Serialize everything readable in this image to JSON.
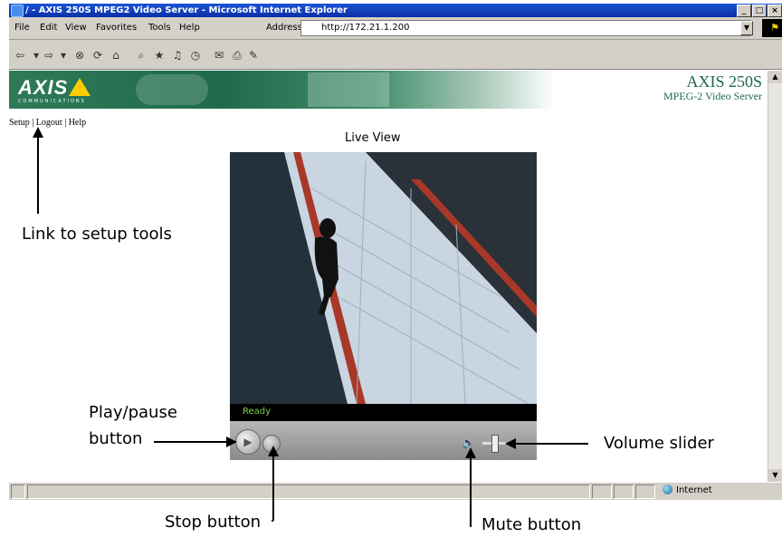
{
  "window": {
    "title": "/ - AXIS 250S MPEG2 Video Server - Microsoft Internet Explorer",
    "controls": [
      "_",
      "□",
      "×"
    ]
  },
  "menu": [
    "File",
    "Edit",
    "View",
    "Favorites",
    "Tools",
    "Help"
  ],
  "address": {
    "label": "Address",
    "url": "http://172.21.1.200"
  },
  "toolbar_icons": [
    "back-icon",
    "forward-icon",
    "stop-icon",
    "refresh-icon",
    "home-icon",
    "search-icon",
    "favorites-icon",
    "media-icon",
    "history-icon",
    "mail-icon",
    "print-icon",
    "edit-icon"
  ],
  "banner": {
    "logo": "AXIS",
    "logo_sub": "COMMUNICATIONS",
    "product_name": "AXIS 250S",
    "product_sub": "MPEG-2 Video Server"
  },
  "nav_links": [
    "Setup",
    "Logout",
    "Help"
  ],
  "nav_separator": "|",
  "live_view_title": "Live View",
  "player": {
    "status": "Ready",
    "volume_level": 0.5
  },
  "statusbar": {
    "zone": "Internet"
  },
  "annotations": {
    "setup_tools": "Link to setup tools",
    "play_pause_line1": "Play/pause",
    "play_pause_line2": "button",
    "stop": "Stop button",
    "mute": "Mute button",
    "volume": "Volume slider"
  }
}
